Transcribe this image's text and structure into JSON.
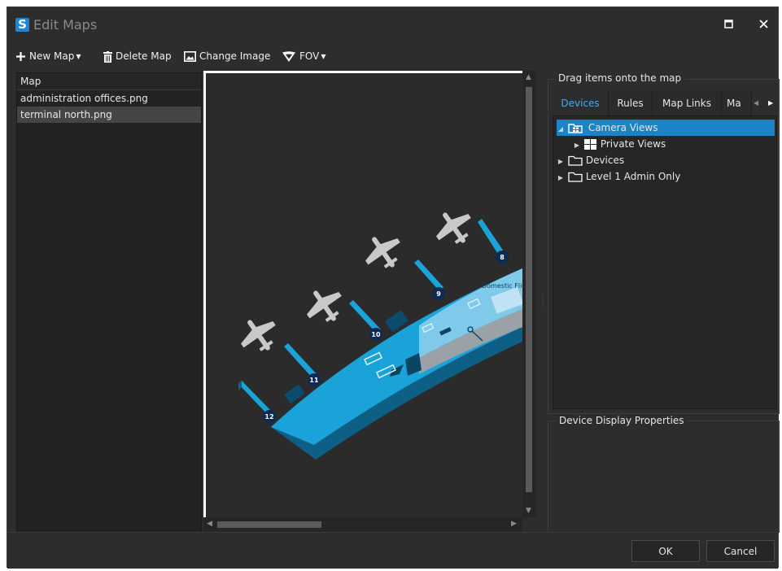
{
  "window": {
    "title": "Edit Maps",
    "logo_letter": "S"
  },
  "toolbar": {
    "new_map": "New Map",
    "delete_map": "Delete Map",
    "change_image": "Change Image",
    "fov": "FOV"
  },
  "map_list": {
    "header": "Map",
    "items": [
      {
        "name": "administration offices.png",
        "selected": false
      },
      {
        "name": "terminal north.png",
        "selected": true
      }
    ]
  },
  "canvas": {
    "gate_labels": [
      "8",
      "9",
      "10",
      "11",
      "12"
    ],
    "area_label": "Domestic Flights"
  },
  "right_pane": {
    "drag_group_label": "Drag items onto the map",
    "tabs": [
      "Devices",
      "Rules",
      "Map Links",
      "Ma"
    ],
    "active_tab": "Devices",
    "tree": [
      {
        "label": "Camera Views",
        "expanded": true,
        "selected": true
      },
      {
        "label": "Private Views",
        "expanded": false,
        "selected": false
      },
      {
        "label": "Devices",
        "expanded": false,
        "selected": false
      },
      {
        "label": "Level 1 Admin Only",
        "expanded": false,
        "selected": false
      }
    ],
    "properties_group_label": "Device Display Properties"
  },
  "footer": {
    "ok": "OK",
    "cancel": "Cancel"
  },
  "colors": {
    "accent": "#1a84c7",
    "map_terminal": "#1aa3d8",
    "map_dark": "#0e5f86"
  }
}
